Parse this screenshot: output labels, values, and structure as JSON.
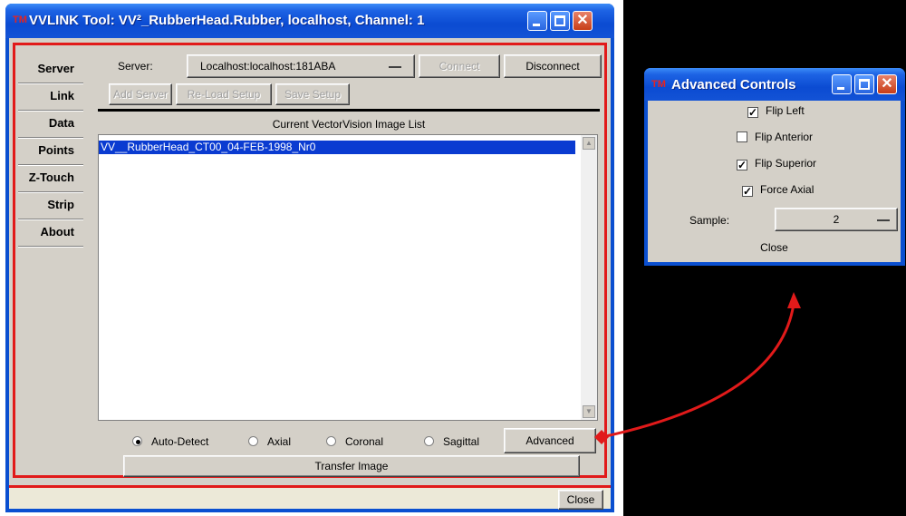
{
  "main_window": {
    "title": "VVLINK Tool: VV²_RubberHead.Rubber, localhost, Channel: 1",
    "icon_text": "TM",
    "nav": [
      "Server",
      "Link",
      "Data",
      "Points",
      "Z-Touch",
      "Strip",
      "About"
    ],
    "server_label": "Server:",
    "server_value": "Localhost:localhost:181ABA",
    "connect": "Connect",
    "disconnect": "Disconnect",
    "add_server": "Add Server",
    "reload_setup": "Re-Load Setup",
    "save_setup": "Save Setup",
    "list_title": "Current VectorVision Image List",
    "list_items": [
      "VV__RubberHead_CT00_04-FEB-1998_Nr0"
    ],
    "orientations": [
      "Auto-Detect",
      "Axial",
      "Coronal",
      "Sagittal"
    ],
    "selected_orientation": "Auto-Detect",
    "advanced": "Advanced",
    "transfer": "Transfer Image",
    "close": "Close"
  },
  "advanced_window": {
    "title": "Advanced Controls",
    "icon_text": "TM",
    "checkboxes": [
      {
        "label": "Flip Left",
        "checked": true
      },
      {
        "label": "Flip Anterior",
        "checked": false
      },
      {
        "label": "Flip Superior",
        "checked": true
      },
      {
        "label": "Force Axial",
        "checked": true
      }
    ],
    "sample_label": "Sample:",
    "sample_value": "2",
    "close": "Close"
  },
  "colors": {
    "highlight": "#e11a1a",
    "titlebar": "#0a4fd0",
    "selection": "#0a3bd1"
  }
}
